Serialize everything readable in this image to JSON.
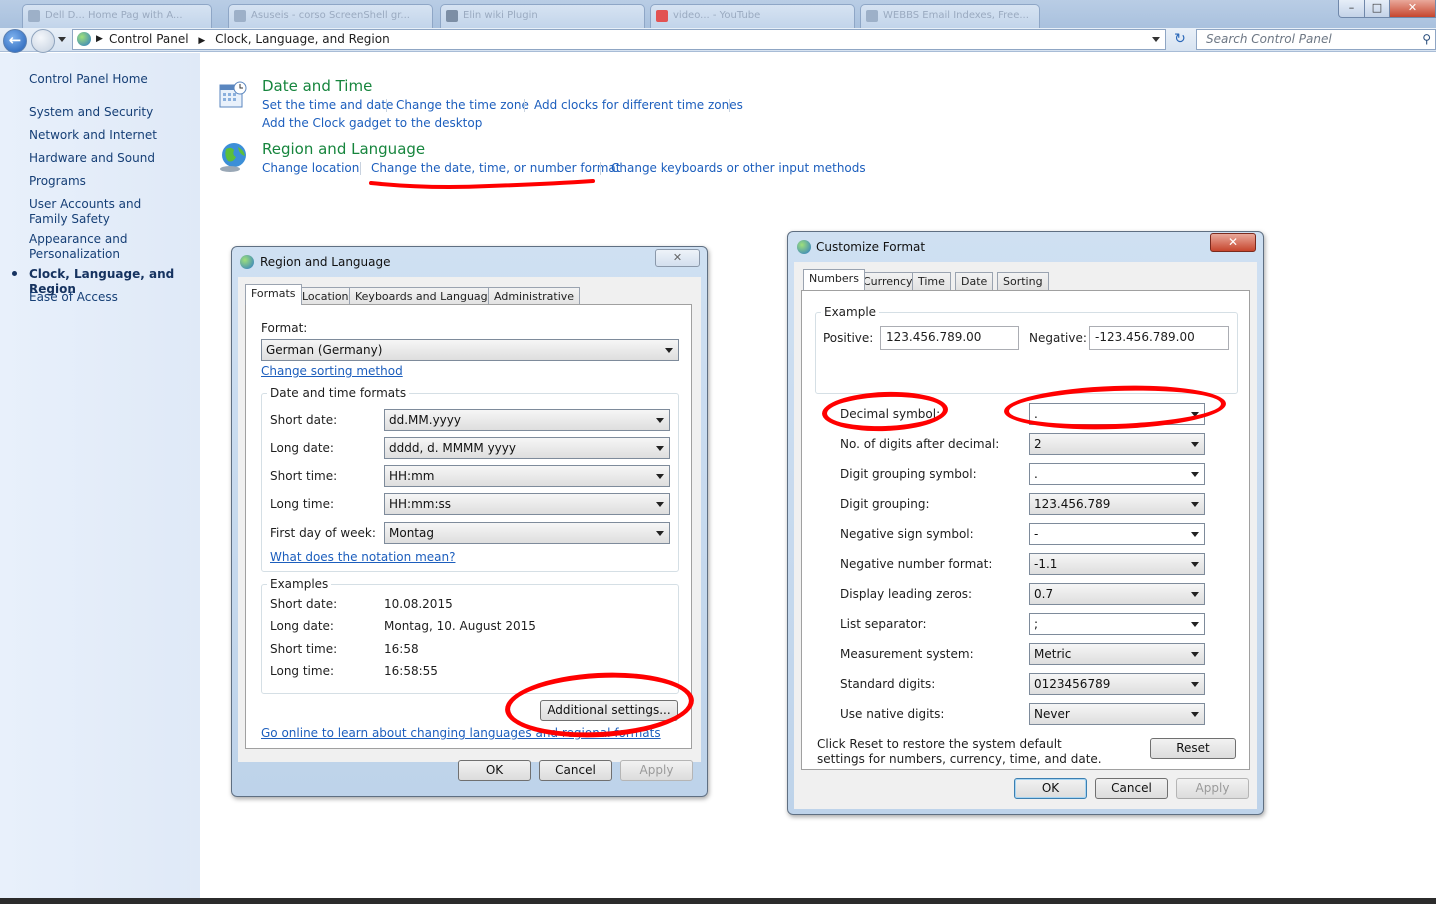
{
  "browser": {
    "tabs": [
      "Dell D... Home Pag with A...",
      "Asuseis - corso ScreenShell gr...",
      "Elin wiki Plugin",
      "video... - YouTube",
      "WEBBS Email Indexes, Free..."
    ]
  },
  "nav": {
    "breadcrumb": [
      "Control Panel",
      "Clock, Language, and Region"
    ],
    "search_placeholder": "Search Control Panel"
  },
  "sidebar": {
    "home": "Control Panel Home",
    "items": [
      "System and Security",
      "Network and Internet",
      "Hardware and Sound",
      "Programs",
      "User Accounts and Family Safety",
      "Appearance and Personalization",
      "Clock, Language, and Region",
      "Ease of Access"
    ]
  },
  "categories": {
    "date_time": {
      "title": "Date and Time",
      "links": [
        "Set the time and date",
        "Change the time zone",
        "Add clocks for different time zones",
        "Add the Clock gadget to the desktop"
      ]
    },
    "region": {
      "title": "Region and Language",
      "links": [
        "Change location",
        "Change the date, time, or number format",
        "Change keyboards or other input methods"
      ]
    }
  },
  "region_dialog": {
    "title": "Region and Language",
    "tabs": [
      "Formats",
      "Location",
      "Keyboards and Languages",
      "Administrative"
    ],
    "format_label": "Format:",
    "format_value": "German (Germany)",
    "sorting_link": "Change sorting method",
    "dt_group": "Date and time formats",
    "fields": [
      {
        "label": "Short date:",
        "value": "dd.MM.yyyy"
      },
      {
        "label": "Long date:",
        "value": "dddd, d. MMMM yyyy"
      },
      {
        "label": "Short time:",
        "value": "HH:mm"
      },
      {
        "label": "Long time:",
        "value": "HH:mm:ss"
      },
      {
        "label": "First day of week:",
        "value": "Montag"
      }
    ],
    "notation_link": "What does the notation mean?",
    "examples_group": "Examples",
    "examples": [
      {
        "label": "Short date:",
        "value": "10.08.2015"
      },
      {
        "label": "Long date:",
        "value": "Montag, 10. August 2015"
      },
      {
        "label": "Short time:",
        "value": "16:58"
      },
      {
        "label": "Long time:",
        "value": "16:58:55"
      }
    ],
    "additional_btn": "Additional settings...",
    "online_link": "Go online to learn about changing languages and regional formats",
    "ok": "OK",
    "cancel": "Cancel",
    "apply": "Apply"
  },
  "customize_dialog": {
    "title": "Customize Format",
    "tabs": [
      "Numbers",
      "Currency",
      "Time",
      "Date",
      "Sorting"
    ],
    "example_group": "Example",
    "positive_label": "Positive:",
    "positive_value": "123.456.789.00",
    "negative_label": "Negative:",
    "negative_value": "-123.456.789.00",
    "fields": [
      {
        "label": "Decimal symbol:",
        "value": "."
      },
      {
        "label": "No. of digits after decimal:",
        "value": "2"
      },
      {
        "label": "Digit grouping symbol:",
        "value": "."
      },
      {
        "label": "Digit grouping:",
        "value": "123.456.789"
      },
      {
        "label": "Negative sign symbol:",
        "value": "-"
      },
      {
        "label": "Negative number format:",
        "value": "-1.1"
      },
      {
        "label": "Display leading zeros:",
        "value": "0.7"
      },
      {
        "label": "List separator:",
        "value": ";"
      },
      {
        "label": "Measurement system:",
        "value": "Metric"
      },
      {
        "label": "Standard digits:",
        "value": "0123456789"
      },
      {
        "label": "Use native digits:",
        "value": "Never"
      }
    ],
    "reset_text": "Click Reset to restore the system default settings for numbers, currency, time, and date.",
    "reset_btn": "Reset",
    "ok": "OK",
    "cancel": "Cancel",
    "apply": "Apply"
  },
  "colors": {
    "link": "#1c5ebd",
    "category_title": "#16853d",
    "annotation": "#ff0000"
  }
}
